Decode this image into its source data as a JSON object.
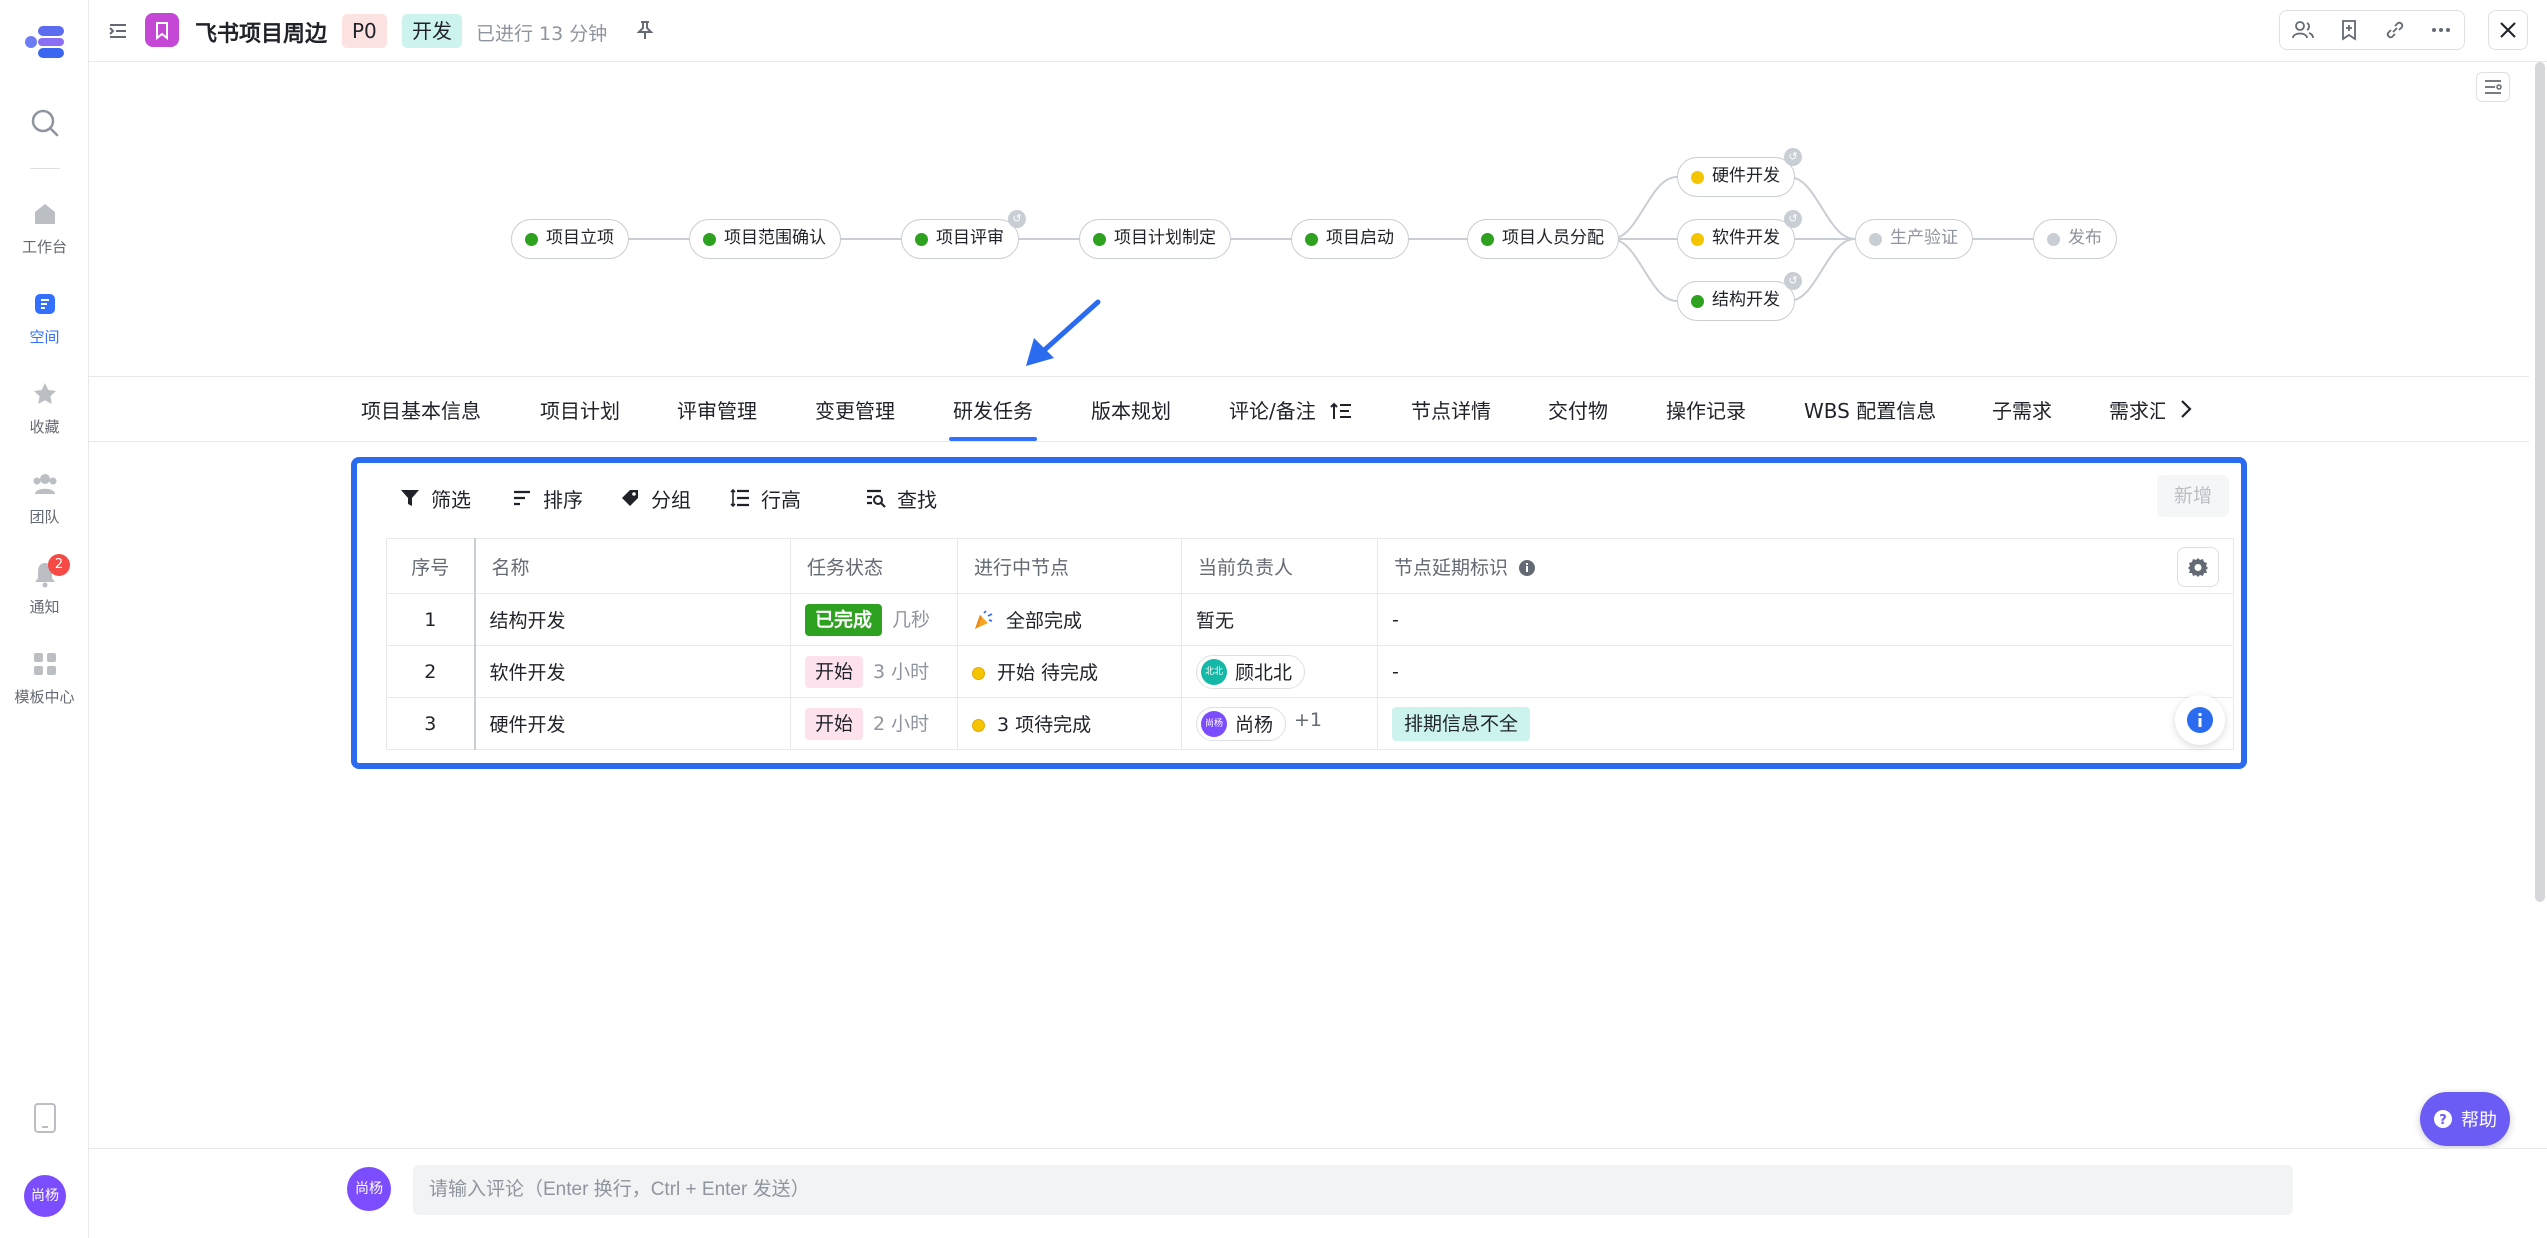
{
  "sidebar": {
    "items": [
      {
        "label": "工作台"
      },
      {
        "label": "空间"
      },
      {
        "label": "收藏"
      },
      {
        "label": "团队"
      },
      {
        "label": "通知",
        "badge": "2"
      },
      {
        "label": "模板中心"
      }
    ],
    "user_avatar": "尚杨"
  },
  "header": {
    "title": "飞书项目周边",
    "priority_tag": "P0",
    "stage_tag": "开发",
    "elapsed": "已进行 13 分钟"
  },
  "flow": {
    "nodes": [
      {
        "label": "项目立项",
        "status": "done"
      },
      {
        "label": "项目范围确认",
        "status": "done"
      },
      {
        "label": "项目评审",
        "status": "done"
      },
      {
        "label": "项目计划制定",
        "status": "done"
      },
      {
        "label": "项目启动",
        "status": "done"
      },
      {
        "label": "项目人员分配",
        "status": "done"
      },
      {
        "label": "硬件开发",
        "status": "in_progress"
      },
      {
        "label": "软件开发",
        "status": "in_progress"
      },
      {
        "label": "结构开发",
        "status": "done"
      },
      {
        "label": "生产验证",
        "status": "pending"
      },
      {
        "label": "发布",
        "status": "pending"
      }
    ]
  },
  "tabs": [
    {
      "label": "项目基本信息"
    },
    {
      "label": "项目计划"
    },
    {
      "label": "评审管理"
    },
    {
      "label": "变更管理"
    },
    {
      "label": "研发任务"
    },
    {
      "label": "版本规划"
    },
    {
      "label": "评论/备注"
    },
    {
      "label": "节点详情"
    },
    {
      "label": "交付物"
    },
    {
      "label": "操作记录"
    },
    {
      "label": "WBS 配置信息"
    },
    {
      "label": "子需求"
    },
    {
      "label": "需求汇"
    }
  ],
  "toolbar": {
    "filter": "筛选",
    "sort": "排序",
    "group": "分组",
    "row_height": "行高",
    "find": "查找",
    "add": "新增"
  },
  "table": {
    "columns": [
      "序号",
      "名称",
      "任务状态",
      "进行中节点",
      "当前负责人",
      "节点延期标识"
    ],
    "rows": [
      {
        "no": "1",
        "name": "结构开发",
        "status": "已完成",
        "duration": "几秒",
        "node": "全部完成",
        "owner": "暂无",
        "delay": "-"
      },
      {
        "no": "2",
        "name": "软件开发",
        "status": "开始",
        "duration": "3 小时",
        "node": "开始 待完成",
        "owner": "顾北北",
        "owner_avatar": "北北",
        "delay": "-"
      },
      {
        "no": "3",
        "name": "硬件开发",
        "status": "开始",
        "duration": "2 小时",
        "node": "3 项待完成",
        "owner": "尚杨",
        "owner_avatar": "尚杨",
        "owner_extra": "+1",
        "delay": "排期信息不全"
      }
    ]
  },
  "help": {
    "label": "帮助"
  },
  "comment": {
    "avatar": "尚杨",
    "placeholder": "请输入评论（Enter 换行，Ctrl + Enter 发送）"
  },
  "colors": {
    "accent": "#3370ff",
    "done": "#2ea121",
    "in_progress": "#f5c400",
    "pending": "#c9cdd4"
  }
}
